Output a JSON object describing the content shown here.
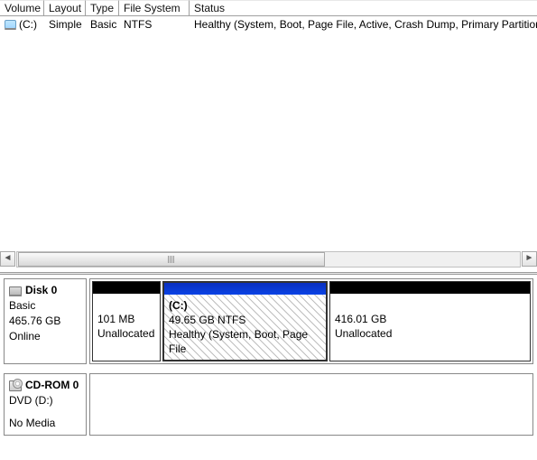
{
  "columns": {
    "volume": "Volume",
    "layout": "Layout",
    "type": "Type",
    "fs": "File System",
    "status": "Status"
  },
  "volumes": [
    {
      "name": "(C:)",
      "layout": "Simple",
      "type": "Basic",
      "fs": "NTFS",
      "status": "Healthy (System, Boot, Page File, Active, Crash Dump, Primary Partition)"
    }
  ],
  "disk0": {
    "title": "Disk 0",
    "type": "Basic",
    "size": "465.76 GB",
    "state": "Online",
    "partitions": {
      "p0": {
        "size": "101 MB",
        "state": "Unallocated"
      },
      "p1": {
        "name": "(C:)",
        "sizefs": "49.65 GB NTFS",
        "status": "Healthy (System, Boot, Page File"
      },
      "p2": {
        "size": "416.01 GB",
        "state": "Unallocated"
      }
    }
  },
  "cdrom": {
    "title": "CD-ROM 0",
    "type": "DVD (D:)",
    "state": "No Media"
  }
}
